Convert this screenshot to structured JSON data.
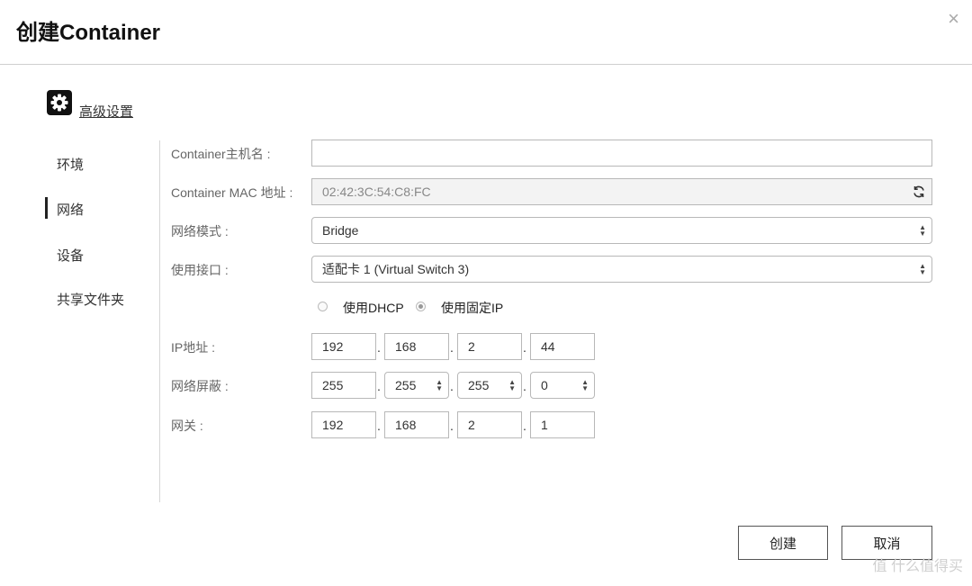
{
  "dialog": {
    "title": "创建Container",
    "close_symbol": "×"
  },
  "advanced": {
    "label": "高级设置",
    "icon": "gear-icon"
  },
  "nav": {
    "items": [
      {
        "label": "环境"
      },
      {
        "label": "网络"
      },
      {
        "label": "设备"
      },
      {
        "label": "共享文件夹"
      }
    ],
    "active": "网络"
  },
  "form": {
    "hostname": {
      "label": "Container主机名 :",
      "value": ""
    },
    "mac": {
      "label": "Container MAC 地址 :",
      "value": "02:42:3C:54:C8:FC"
    },
    "network_mode": {
      "label": "网络模式 :",
      "value": "Bridge"
    },
    "interface": {
      "label": "使用接口 :",
      "value": "适配卡 1 (Virtual Switch 3)"
    },
    "ip_mode": {
      "dhcp_label": "使用DHCP",
      "static_label": "使用固定IP",
      "selected": "static"
    },
    "ip": {
      "label": "IP地址 :",
      "octets": [
        "192",
        "168",
        "2",
        "44"
      ]
    },
    "netmask": {
      "label": "网络屏蔽 :",
      "octets": [
        "255",
        "255",
        "255",
        "0"
      ]
    },
    "gateway": {
      "label": "网关 :",
      "octets": [
        "192",
        "168",
        "2",
        "1"
      ]
    },
    "octet_separator": "."
  },
  "buttons": {
    "create": "创建",
    "cancel": "取消"
  },
  "watermark": "值 什么值得买"
}
